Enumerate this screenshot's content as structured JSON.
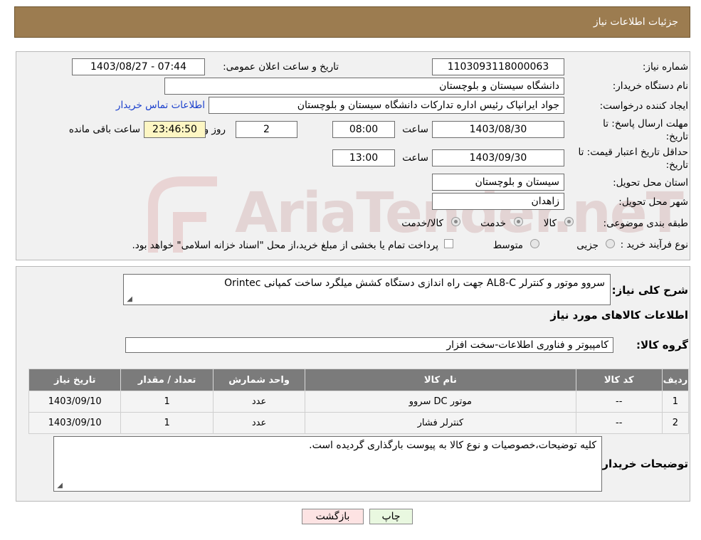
{
  "header": {
    "title": "جزئیات اطلاعات نیاز"
  },
  "form": {
    "need_number_label": "شماره نیاز:",
    "need_number": "1103093118000063",
    "announce_label": "تاریخ و ساعت اعلان عمومی:",
    "announce_value": "1403/08/27 - 07:44",
    "buyer_org_label": "نام دستگاه خریدار:",
    "buyer_org": "دانشگاه سیستان و بلوچستان",
    "creator_label": "ایجاد کننده درخواست:",
    "creator": "جواد ایرانپاک رئیس اداره تدارکات دانشگاه سیستان و بلوچستان",
    "contact_link": "اطلاعات تماس خریدار",
    "deadline_label_line1": "مهلت ارسال پاسخ: تا",
    "deadline_label_line2": "تاریخ:",
    "deadline_date": "1403/08/30",
    "time_label": "ساعت",
    "deadline_time": "08:00",
    "days_value": "2",
    "days_label": "روز و",
    "remaining_time": "23:46:50",
    "remaining_label": "ساعت باقی مانده",
    "validity_label_line1": "حداقل تاریخ اعتبار قیمت: تا",
    "validity_label_line2": "تاریخ:",
    "validity_date": "1403/09/30",
    "validity_time": "13:00",
    "province_label": "استان محل تحویل:",
    "province": "سیستان و بلوچستان",
    "city_label": "شهر محل تحویل:",
    "city": "زاهدان",
    "category_label": "طبقه بندی موضوعی:",
    "category_options": [
      "کالا",
      "خدمت",
      "کالا/خدمت"
    ],
    "purchase_type_label": "نوع فرآیند خرید :",
    "purchase_options": [
      "جزیی",
      "متوسط"
    ],
    "purchase_note": "پرداخت تمام یا بخشی از مبلغ خرید،از محل \"اسناد خزانه اسلامی\" خواهد بود."
  },
  "details": {
    "summary_label": "شرح کلی نیاز:",
    "summary": "سروو موتور و کنترلر AL8-C  جهت راه اندازی دستگاه کشش میلگرد ساخت کمپانی Orintec",
    "goods_info_title": "اطلاعات کالاهای مورد نیاز",
    "goods_group_label": "گروه کالا:",
    "goods_group": "کامپیوتر و فناوری اطلاعات-سخت افزار",
    "table": {
      "columns": [
        "ردیف",
        "کد کالا",
        "نام کالا",
        "واحد شمارش",
        "تعداد / مقدار",
        "تاریخ نیاز"
      ],
      "rows": [
        [
          "1",
          "--",
          "موتور DC سروو",
          "عدد",
          "1",
          "1403/09/10"
        ],
        [
          "2",
          "--",
          "کنترلر فشار",
          "عدد",
          "1",
          "1403/09/10"
        ]
      ]
    },
    "buyer_notes_label": "توضیحات خریدار:",
    "buyer_notes": "کلیه توضیحات،خصوصیات و نوع کالا به پیوست بارگذاری گردیده است."
  },
  "buttons": {
    "print": "چاپ",
    "back": "بازگشت"
  },
  "watermark": {
    "text": "AriaTender.neT"
  },
  "colors": {
    "header_bg": "#9c7c50",
    "table_header_bg": "#7b7b7b",
    "link": "#1a3fcc",
    "timer_bg": "#fdf6c3"
  }
}
